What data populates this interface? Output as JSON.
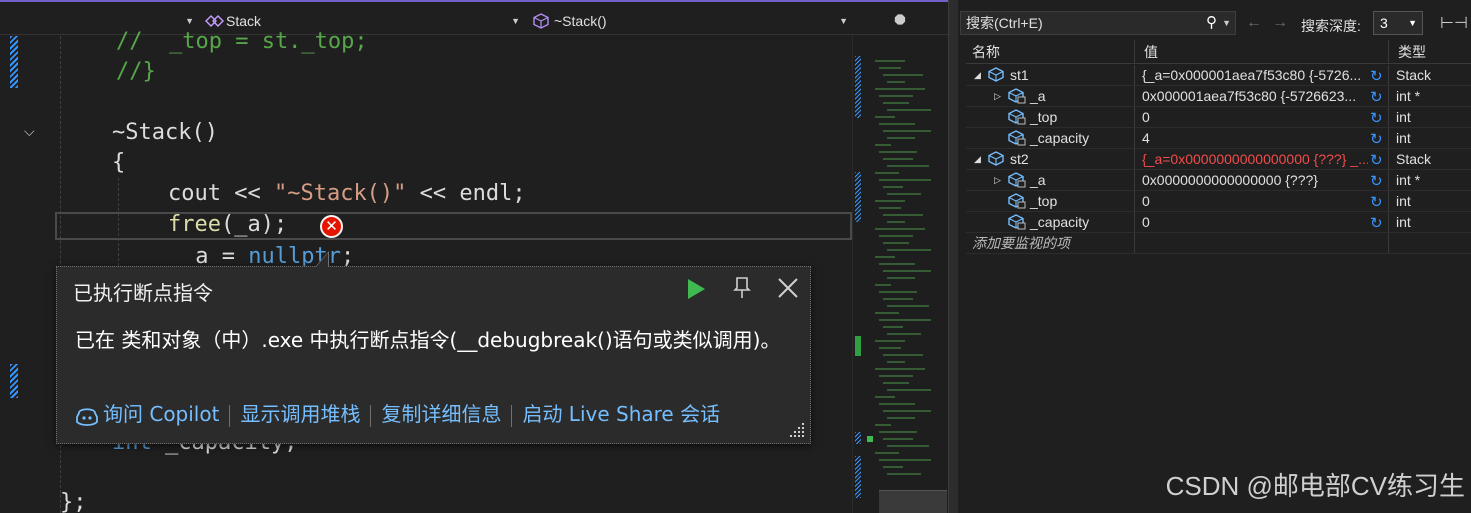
{
  "editor": {
    "nav": {
      "member_dropdown": "Stack",
      "function_dropdown": "~Stack()"
    },
    "code_lines": [
      {
        "tokens": [
          {
            "t": "//  _top = st._top;",
            "c": "cmt"
          }
        ]
      },
      {
        "tokens": [
          {
            "t": "//}",
            "c": "cmt"
          }
        ]
      },
      {
        "tokens": []
      },
      {
        "tokens": [
          {
            "t": "~Stack()",
            "c": "txt"
          }
        ]
      },
      {
        "tokens": [
          {
            "t": "{",
            "c": "txt"
          }
        ]
      },
      {
        "tokens": [
          {
            "t": "cout << ",
            "c": "txt"
          },
          {
            "t": "\"~Stack()\"",
            "c": "str"
          },
          {
            "t": " << endl;",
            "c": "txt"
          }
        ]
      },
      {
        "tokens": [
          {
            "t": "free",
            "c": "fn"
          },
          {
            "t": "(_a);",
            "c": "txt"
          }
        ]
      },
      {
        "tokens": [
          {
            "t": "_a = ",
            "c": "txt"
          },
          {
            "t": "nullptr",
            "c": "kw"
          },
          {
            "t": ";",
            "c": "txt"
          }
        ]
      },
      {
        "tokens": [
          {
            "t": "int",
            "c": "kw"
          },
          {
            "t": " _capacity;",
            "c": "txt"
          }
        ]
      },
      {
        "tokens": [
          {
            "t": "};",
            "c": "txt"
          }
        ]
      }
    ]
  },
  "popup": {
    "title": "已执行断点指令",
    "message": "已在 类和对象（中）.exe 中执行断点指令(__debugbreak()语句或类似调用)。",
    "links": [
      "询问 Copilot",
      "显示调用堆栈",
      "复制详细信息",
      "启动 Live Share 会话"
    ]
  },
  "watch": {
    "search_placeholder": "搜索(Ctrl+E)",
    "depth_label": "搜索深度:",
    "depth_value": "3",
    "columns": {
      "name": "名称",
      "value": "值",
      "type": "类型"
    },
    "rows": [
      {
        "level": 0,
        "expander": "open",
        "name": "st1",
        "value": "{_a=0x000001aea7f53c80 {-5726...",
        "type": "Stack",
        "value_red": false
      },
      {
        "level": 1,
        "expander": "closed",
        "name": "_a",
        "value": "0x000001aea7f53c80 {-5726623...",
        "type": "int *",
        "value_red": false
      },
      {
        "level": 1,
        "expander": "none",
        "name": "_top",
        "value": "0",
        "type": "int",
        "value_red": false
      },
      {
        "level": 1,
        "expander": "none",
        "name": "_capacity",
        "value": "4",
        "type": "int",
        "value_red": false
      },
      {
        "level": 0,
        "expander": "open",
        "name": "st2",
        "value": "{_a=0x0000000000000000 {???} _...",
        "type": "Stack",
        "value_red": true
      },
      {
        "level": 1,
        "expander": "closed",
        "name": "_a",
        "value": "0x0000000000000000 {???}",
        "type": "int *",
        "value_red": false
      },
      {
        "level": 1,
        "expander": "none",
        "name": "_top",
        "value": "0",
        "type": "int",
        "value_red": false
      },
      {
        "level": 1,
        "expander": "none",
        "name": "_capacity",
        "value": "0",
        "type": "int",
        "value_red": false
      }
    ],
    "add_item_placeholder": "添加要监视的项"
  },
  "watermark": "CSDN @邮电部CV练习生",
  "colors": {
    "accent": "#7060c8",
    "link": "#75beff",
    "error": "#e51400",
    "comment": "#57a64a",
    "keyword": "#569cd6",
    "string": "#d69d85",
    "function": "#dcdcaa"
  }
}
